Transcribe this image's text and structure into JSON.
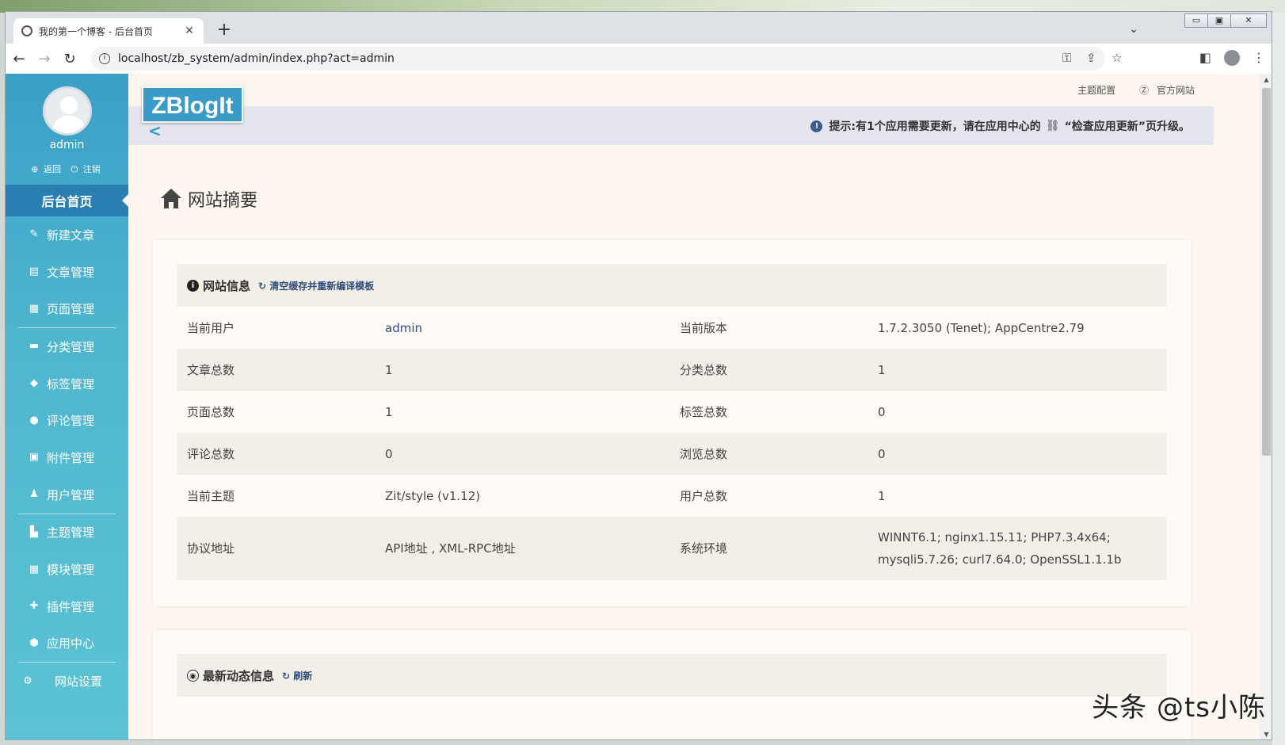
{
  "browser": {
    "tab_title": "我的第一个博客 - 后台首页",
    "url": "localhost/zb_system/admin/index.php?act=admin"
  },
  "sidebar": {
    "username": "admin",
    "back_label": "返回",
    "logout_label": "注销",
    "items": [
      {
        "label": "后台首页",
        "icon": "home-icon"
      },
      {
        "label": "新建文章",
        "icon": "edit-icon"
      },
      {
        "label": "文章管理",
        "icon": "article-icon"
      },
      {
        "label": "页面管理",
        "icon": "page-icon"
      },
      {
        "label": "分类管理",
        "icon": "folder-icon"
      },
      {
        "label": "标签管理",
        "icon": "tag-icon"
      },
      {
        "label": "评论管理",
        "icon": "comment-icon"
      },
      {
        "label": "附件管理",
        "icon": "attachment-icon"
      },
      {
        "label": "用户管理",
        "icon": "users-icon"
      },
      {
        "label": "主题管理",
        "icon": "theme-icon"
      },
      {
        "label": "模块管理",
        "icon": "module-icon"
      },
      {
        "label": "插件管理",
        "icon": "plugin-icon"
      },
      {
        "label": "应用中心",
        "icon": "appcenter-icon"
      },
      {
        "label": "网站设置",
        "icon": "gear-icon"
      }
    ]
  },
  "header": {
    "logo_text": "ZBlogIt",
    "theme_config": "主题配置",
    "official_site": "官方网站",
    "notice_prefix": "提示:有1个应用需要更新，请在应用中心的",
    "notice_link": "“检查应用更新”页升级。"
  },
  "main": {
    "page_title": "网站摘要",
    "site_info": {
      "title": "网站信息",
      "action": "清空缓存并重新编译模板",
      "rows": [
        {
          "k1": "当前用户",
          "v1": "admin",
          "k2": "当前版本",
          "v2": "1.7.2.3050 (Tenet); AppCentre2.79"
        },
        {
          "k1": "文章总数",
          "v1": "1",
          "k2": "分类总数",
          "v2": "1"
        },
        {
          "k1": "页面总数",
          "v1": "1",
          "k2": "标签总数",
          "v2": "0"
        },
        {
          "k1": "评论总数",
          "v1": "0",
          "k2": "浏览总数",
          "v2": "0"
        },
        {
          "k1": "当前主题",
          "v1": "Zit/style (v1.12)",
          "k2": "用户总数",
          "v2": "1"
        },
        {
          "k1": "协议地址",
          "v1": "API地址 , XML-RPC地址",
          "k2": "系统环境",
          "v2a": "WINNT6.1; nginx1.15.11; PHP7.3.4x64;",
          "v2b": "mysqli5.7.26; curl7.64.0; OpenSSL1.1.1b"
        }
      ]
    },
    "news": {
      "title": "最新动态信息",
      "action": "刷新"
    }
  },
  "watermark": "头条 @ts小陈",
  "colors": {
    "sidebar": "#3a9fc7",
    "accent": "#2a7fb2",
    "page_bg": "#fdf7ef"
  }
}
